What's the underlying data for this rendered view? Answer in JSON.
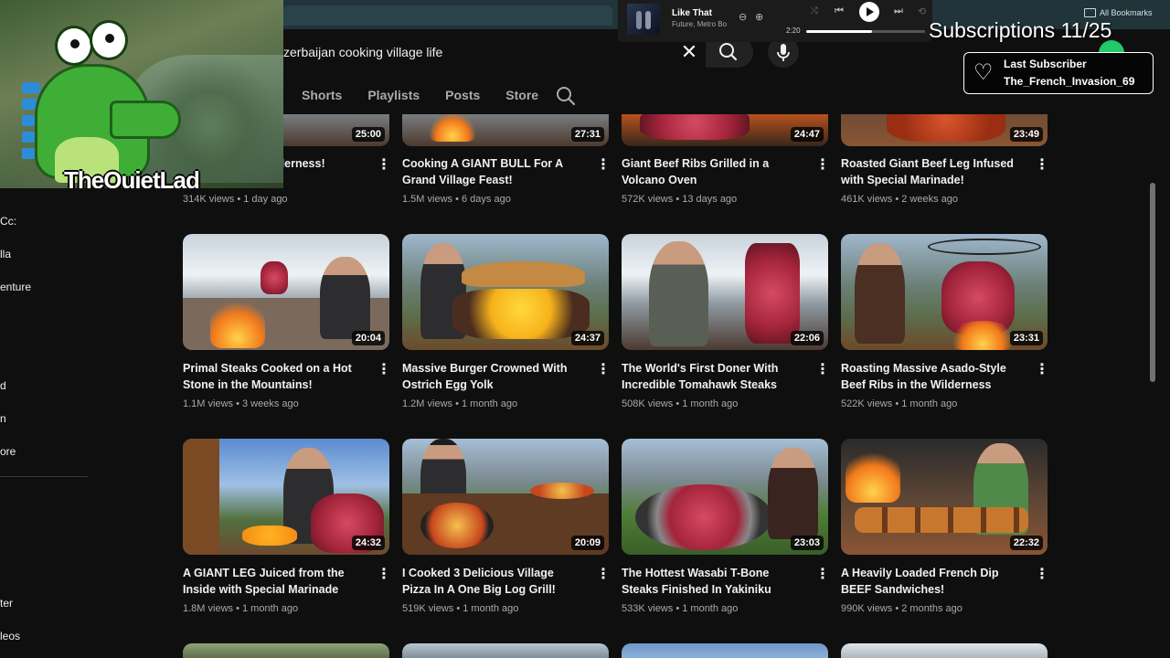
{
  "browser": {
    "bookmarks_label": "All Bookmarks"
  },
  "player": {
    "track_title": "Like That",
    "track_artist": "Future, Metro Bo",
    "elapsed": "2:20",
    "progress": 0.55
  },
  "overlay": {
    "subs_counter": "Subscriptions 11/25",
    "last_subscriber_label": "Last Subscriber",
    "last_subscriber_name": "The_French_Invasion_69",
    "streamer_tag": "TheQuietLad"
  },
  "search": {
    "query": "zerbaijan cooking village life"
  },
  "channel_tabs": [
    "Shorts",
    "Playlists",
    "Posts",
    "Store"
  ],
  "sidebar_fragments": [
    "Cc:",
    "lla",
    "enture",
    "d",
    "n",
    "ore",
    "ter",
    "leos"
  ],
  "videos": [
    {
      "title": "o Black Smoked lderness!",
      "views": "314K views",
      "age": "1 day ago",
      "duration": "25:00"
    },
    {
      "title": "Cooking A GIANT BULL For A Grand Village Feast!",
      "views": "1.5M views",
      "age": "6 days ago",
      "duration": "27:31"
    },
    {
      "title": "Giant Beef Ribs Grilled in a Volcano Oven",
      "views": "572K views",
      "age": "13 days ago",
      "duration": "24:47"
    },
    {
      "title": "Roasted Giant Beef Leg Infused with Special Marinade!",
      "views": "461K views",
      "age": "2 weeks ago",
      "duration": "23:49"
    },
    {
      "title": "Primal Steaks Cooked on a Hot Stone in the Mountains!",
      "views": "1.1M views",
      "age": "3 weeks ago",
      "duration": "20:04"
    },
    {
      "title": "Massive Burger Crowned With Ostrich Egg Yolk",
      "views": "1.2M views",
      "age": "1 month ago",
      "duration": "24:37"
    },
    {
      "title": "The World's First Doner With Incredible Tomahawk Steaks",
      "views": "508K views",
      "age": "1 month ago",
      "duration": "22:06"
    },
    {
      "title": "Roasting Massive Asado-Style Beef Ribs in the Wilderness",
      "views": "522K views",
      "age": "1 month ago",
      "duration": "23:31"
    },
    {
      "title": "A GIANT LEG Juiced from the Inside with Special Marinade",
      "views": "1.8M views",
      "age": "1 month ago",
      "duration": "24:32"
    },
    {
      "title": "I Cooked 3 Delicious Village Pizza In A One Big Log Grill!",
      "views": "519K views",
      "age": "1 month ago",
      "duration": "20:09"
    },
    {
      "title": "The Hottest Wasabi T-Bone Steaks Finished In Yakiniku Sauce!",
      "views": "533K views",
      "age": "1 month ago",
      "duration": "23:03"
    },
    {
      "title": "A Heavily Loaded French Dip BEEF Sandwiches!",
      "views": "990K views",
      "age": "2 months ago",
      "duration": "22:32"
    }
  ]
}
